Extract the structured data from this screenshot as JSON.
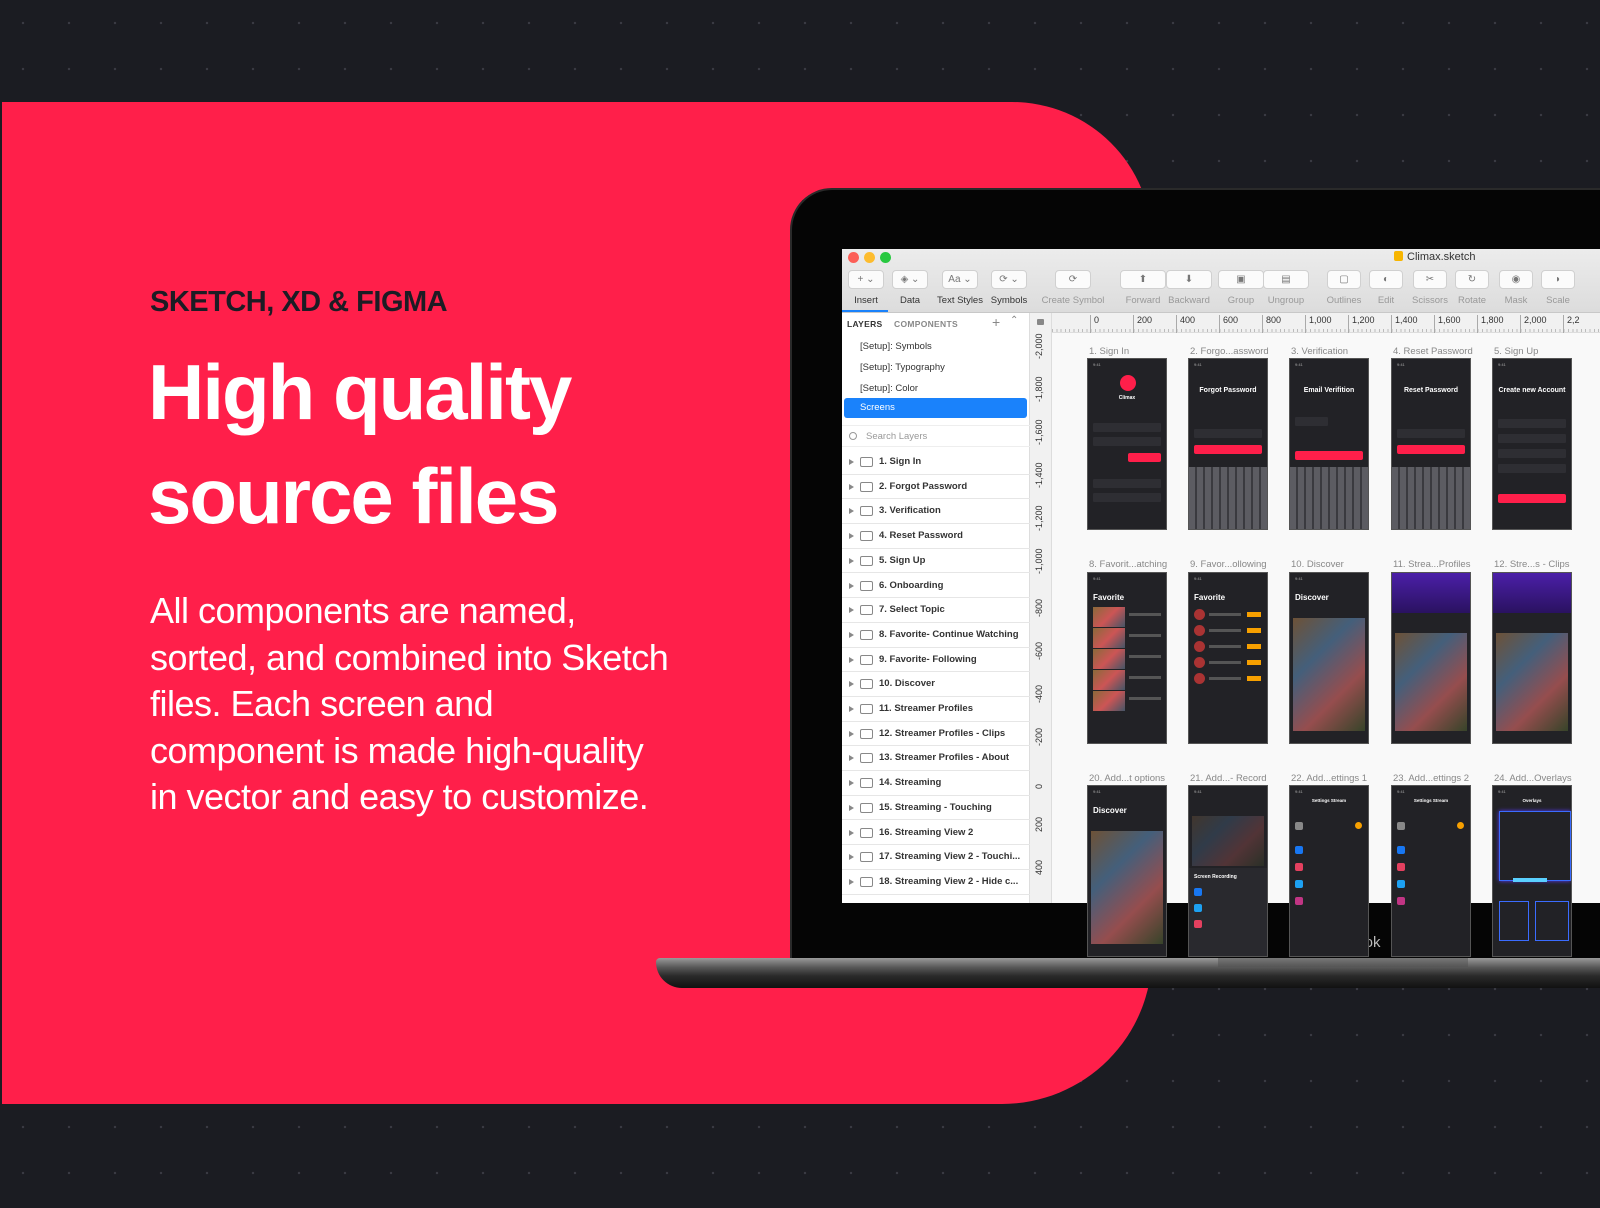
{
  "promo": {
    "eyebrow": "SKETCH, XD & FIGMA",
    "headline_line1": "High quality",
    "headline_line2": "source files",
    "paragraph": "All components are named, sorted, and combined into Sketch files. Each screen and component is made high-quality in vector and easy to customize.",
    "accent_color": "#ff1f4a",
    "background_color": "#1b1c22"
  },
  "device": {
    "brand": "MacBook"
  },
  "window": {
    "title": "Climax.sketch",
    "traffic_lights": [
      "#fc5f57",
      "#fdbc2e",
      "#28c840"
    ]
  },
  "toolbar": {
    "items": [
      {
        "label": "Insert",
        "icon": "plus-icon",
        "glyph": "+ ⌄"
      },
      {
        "label": "Data",
        "icon": "layers-stack-icon",
        "glyph": "◈ ⌄"
      },
      {
        "label": "Text Styles",
        "icon": "text-style-icon",
        "glyph": "Aa ⌄"
      },
      {
        "label": "Symbols",
        "icon": "symbol-icon",
        "glyph": "⟳ ⌄"
      },
      {
        "label": "Create Symbol",
        "icon": "create-symbol-icon",
        "glyph": "⟳"
      },
      {
        "label": "Forward",
        "icon": "forward-icon",
        "glyph": "⬆"
      },
      {
        "label": "Backward",
        "icon": "backward-icon",
        "glyph": "⬇"
      },
      {
        "label": "Group",
        "icon": "group-icon",
        "glyph": "▣"
      },
      {
        "label": "Ungroup",
        "icon": "ungroup-icon",
        "glyph": "▤"
      },
      {
        "label": "Outlines",
        "icon": "outlines-icon",
        "glyph": "▢"
      },
      {
        "label": "Edit",
        "icon": "edit-icon",
        "glyph": "◐"
      },
      {
        "label": "Scissors",
        "icon": "scissors-icon",
        "glyph": "✂"
      },
      {
        "label": "Rotate",
        "icon": "rotate-icon",
        "glyph": "↻"
      },
      {
        "label": "Mask",
        "icon": "mask-icon",
        "glyph": "◉"
      },
      {
        "label": "Scale",
        "icon": "scale-icon",
        "glyph": "◗"
      }
    ]
  },
  "layers_panel": {
    "tab_layers": "LAYERS",
    "tab_components": "COMPONENTS",
    "pages": [
      "[Setup]: Symbols",
      "[Setup]: Typography",
      "[Setup]: Color"
    ],
    "selected_page": "Screens",
    "search_placeholder": "Search Layers",
    "layers": [
      "1. Sign In",
      "2. Forgot Password",
      "3. Verification",
      "4. Reset Password",
      "5. Sign Up",
      "6. Onboarding",
      "7. Select Topic",
      "8. Favorite- Continue Watching",
      "9. Favorite- Following",
      "10. Discover",
      "11. Streamer Profiles",
      "12. Streamer Profiles - Clips",
      "13. Streamer Profiles - About",
      "14. Streaming",
      "15. Streaming - Touching",
      "16. Streaming View 2",
      "17. Streaming View 2 - Touchi...",
      "18. Streaming View 2 - Hide c..."
    ]
  },
  "rulers": {
    "horizontal": [
      "0",
      "200",
      "400",
      "600",
      "800",
      "1,000",
      "1,200",
      "1,400",
      "1,600",
      "1,800",
      "2,000",
      "2,2"
    ],
    "vertical": [
      "-2,000",
      "-1,800",
      "-1,600",
      "-1,400",
      "-1,200",
      "-1,000",
      "-800",
      "-600",
      "-400",
      "-200",
      "0",
      "200",
      "400"
    ]
  },
  "artboards": [
    {
      "label": "1. Sign In",
      "heading": "Climax",
      "kind": "signin"
    },
    {
      "label": "2. Forgo...assword",
      "heading": "Forgot Password",
      "kind": "keyboard"
    },
    {
      "label": "3. Verification",
      "heading": "Email Verifition",
      "kind": "keypad"
    },
    {
      "label": "4. Reset Password",
      "heading": "Reset Password",
      "kind": "keyboard"
    },
    {
      "label": "5. Sign Up",
      "heading": "Create new Account",
      "kind": "form"
    },
    {
      "label": "8. Favorit...atching",
      "heading": "Favorite",
      "kind": "list"
    },
    {
      "label": "9. Favor...ollowing",
      "heading": "Favorite",
      "kind": "follow"
    },
    {
      "label": "10. Discover",
      "heading": "Discover",
      "kind": "grid"
    },
    {
      "label": "11. Strea...Profiles",
      "heading": "",
      "kind": "profile"
    },
    {
      "label": "12. Stre...s - Clips",
      "heading": "",
      "kind": "profile"
    },
    {
      "label": "20. Add...t options",
      "heading": "Discover",
      "kind": "grid"
    },
    {
      "label": "21. Add...- Record",
      "heading": "Screen Recording",
      "kind": "record"
    },
    {
      "label": "22. Add...ettings 1",
      "heading": "Settings Stream",
      "kind": "settings"
    },
    {
      "label": "23. Add...ettings 2",
      "heading": "Settings Stream",
      "kind": "settings"
    },
    {
      "label": "24. Add...Overlays",
      "heading": "Overlays",
      "kind": "overlay"
    }
  ]
}
